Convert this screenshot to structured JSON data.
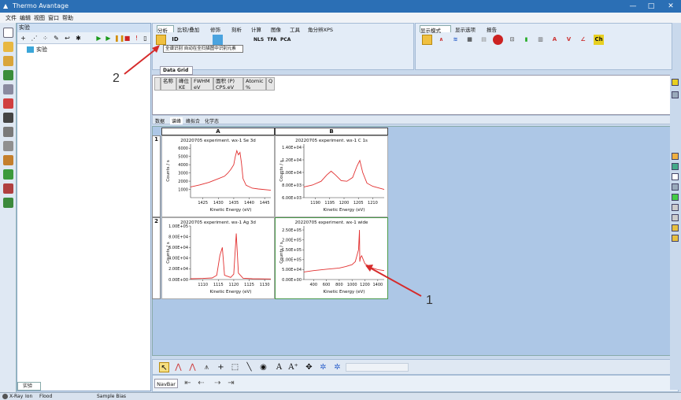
{
  "app": {
    "title": "Thermo Avantage",
    "controls": {
      "minimize": "—",
      "maximize": "□",
      "close": "✕"
    }
  },
  "menu": [
    "文件",
    "编辑",
    "视图",
    "窗口",
    "帮助"
  ],
  "project": {
    "header": "实验",
    "tree_item": "实验",
    "tab": "实验"
  },
  "ribbon": {
    "left_tabs": [
      "分析",
      "比较/叠加",
      "修饰",
      "刻析",
      "计算",
      "图像",
      "工具",
      "角分辨XPS"
    ],
    "left_icons": [
      "",
      "ID",
      "",
      "",
      "",
      "",
      "",
      "NLS",
      "TFA",
      "PCA"
    ],
    "right_tabs": [
      "显示模式",
      "显示选项",
      "报告"
    ],
    "tooltip": "全谱识别 自动在全扫描图中识别元素"
  },
  "document_tab": {
    "label": "Data Grid",
    "close": "×"
  },
  "data_grid": {
    "columns": [
      [
        "名称",
        ""
      ],
      [
        "峰位",
        "KE"
      ],
      [
        "FWHM",
        "eV"
      ],
      [
        "面积 (P)",
        "CPS.eV"
      ],
      [
        "Atomic",
        "%"
      ],
      [
        "Q",
        ""
      ]
    ]
  },
  "sub_tabs": [
    "数据",
    "谱峰",
    "峰拟合",
    "化学态"
  ],
  "grid": {
    "col_headers": [
      "A",
      "B"
    ],
    "row_headers": [
      "1",
      "2"
    ]
  },
  "chart_data": [
    {
      "type": "line",
      "title": "20220705 experiment. wx-1 Se 3d",
      "xlabel": "Kinetic Energy (eV)",
      "ylabel": "Counts / s",
      "x_ticks": [
        "1425",
        "1430",
        "1435",
        "1440",
        "1445"
      ],
      "y_ticks": [
        "1000",
        "2000",
        "3000",
        "4000",
        "5000",
        "6000"
      ],
      "xlim": [
        1421,
        1447
      ],
      "ylim": [
        0,
        6500
      ],
      "x": [
        1421,
        1424,
        1427,
        1430,
        1432,
        1433,
        1434,
        1435,
        1435.5,
        1436,
        1436.5,
        1437,
        1437.5,
        1438,
        1439,
        1441,
        1443,
        1447
      ],
      "y": [
        1300,
        1550,
        1850,
        2300,
        2600,
        2950,
        3400,
        4000,
        5000,
        5700,
        5200,
        5500,
        4200,
        2300,
        1500,
        1150,
        1050,
        900
      ]
    },
    {
      "type": "line",
      "title": "20220705 experiment. wx-1 C 1s",
      "xlabel": "Kinetic Energy (eV)",
      "ylabel": "Counts / s",
      "x_ticks": [
        "1190",
        "1195",
        "1200",
        "1205",
        "1210"
      ],
      "y_ticks": [
        "6.00E+03",
        "8.00E+03",
        "1.00E+04",
        "1.20E+04",
        "1.40E+04"
      ],
      "xlim": [
        1186,
        1214
      ],
      "ylim": [
        6000,
        14500
      ],
      "x": [
        1186,
        1189,
        1192,
        1194,
        1195.5,
        1197,
        1199,
        1201,
        1203,
        1204.5,
        1205.5,
        1206.5,
        1208,
        1210,
        1214
      ],
      "y": [
        7700,
        8000,
        8600,
        9600,
        10200,
        9600,
        8700,
        8600,
        9200,
        11000,
        11900,
        10000,
        8300,
        7800,
        7300
      ]
    },
    {
      "type": "line",
      "title": "20220705 experiment. wx-1 Ag 3d",
      "xlabel": "Kinetic Energy (eV)",
      "ylabel": "Counts / s",
      "x_ticks": [
        "1110",
        "1115",
        "1120",
        "1125",
        "1130"
      ],
      "y_ticks": [
        "0.00E+00",
        "2.00E+04",
        "4.00E+04",
        "6.00E+04",
        "8.00E+04",
        "1.00E+05"
      ],
      "xlim": [
        1106,
        1132
      ],
      "ylim": [
        0,
        100000
      ],
      "x": [
        1106,
        1110,
        1113,
        1114.5,
        1115.5,
        1116.3,
        1117,
        1119,
        1120,
        1120.8,
        1121.5,
        1123,
        1126,
        1132
      ],
      "y": [
        1500,
        2000,
        3000,
        8000,
        45000,
        60000,
        8000,
        4000,
        10000,
        86000,
        12000,
        2500,
        1500,
        1000
      ]
    },
    {
      "type": "line",
      "title": "20220705 experiment. wx-1 wide",
      "xlabel": "Kinetic Energy (eV)",
      "ylabel": "Counts / s",
      "x_ticks": [
        "400",
        "600",
        "800",
        "1000",
        "1200",
        "1400"
      ],
      "y_ticks": [
        "0.00E+00",
        "5.00E+04",
        "1.00E+05",
        "1.50E+05",
        "2.00E+05",
        "2.50E+05"
      ],
      "xlim": [
        250,
        1500
      ],
      "ylim": [
        0,
        270000
      ],
      "x": [
        250,
        400,
        600,
        800,
        900,
        1000,
        1050,
        1100,
        1115,
        1120,
        1130,
        1150,
        1200,
        1250,
        1300,
        1400,
        1500
      ],
      "y": [
        38000,
        45000,
        52000,
        58000,
        65000,
        75000,
        90000,
        150000,
        250000,
        90000,
        110000,
        120000,
        80000,
        70000,
        60000,
        50000,
        45000
      ]
    }
  ],
  "navbar": {
    "label": "NavBar"
  },
  "status": [
    "X-Ray",
    "Ion",
    "Flood",
    "Sample Bias"
  ],
  "annotations": [
    "2",
    "1"
  ],
  "colors": {
    "title_bar": "#2b6fb5",
    "plot_line": "#e23030",
    "arrow": "#d62b2b",
    "chart_bg": "#adc7e6"
  }
}
